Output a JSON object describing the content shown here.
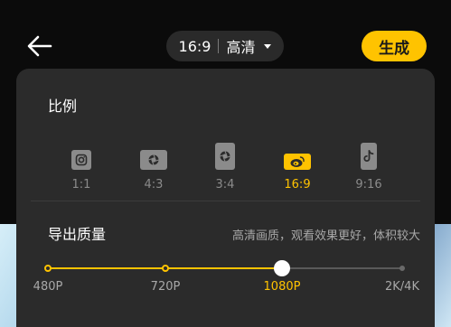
{
  "topbar": {
    "back_icon": "arrow-left-icon",
    "ratio": "16:9",
    "quality": "高清",
    "generate_label": "生成",
    "accent": "#ffc300"
  },
  "panel": {
    "ratio_title": "比例",
    "ratios": [
      {
        "label": "1:1",
        "icon": "instagram-icon",
        "selected": false
      },
      {
        "label": "4:3",
        "icon": "camera-aperture-icon",
        "selected": false
      },
      {
        "label": "3:4",
        "icon": "camera-aperture-icon",
        "selected": false
      },
      {
        "label": "16:9",
        "icon": "weibo-icon",
        "selected": true
      },
      {
        "label": "9:16",
        "icon": "tiktok-icon",
        "selected": false
      }
    ],
    "quality_title": "导出质量",
    "quality_desc": "高清画质，观看效果更好，体积较大",
    "qualities": [
      "480P",
      "720P",
      "1080P",
      "2K/4K"
    ],
    "selected_quality_index": 2
  }
}
